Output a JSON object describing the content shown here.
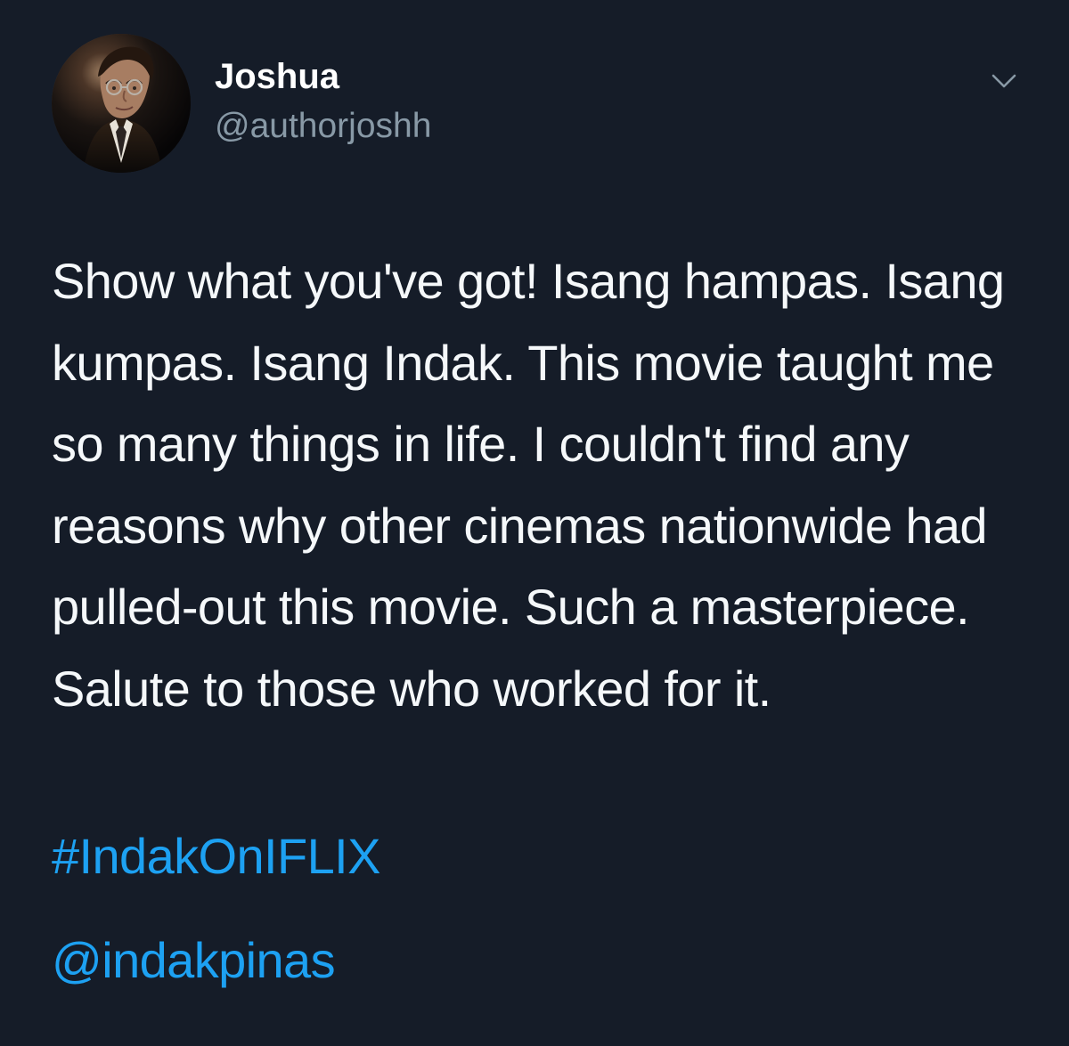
{
  "colors": {
    "background": "#151c28",
    "text": "#f5f8fa",
    "secondary_text": "#8899a6",
    "link": "#1da1f2"
  },
  "tweet": {
    "author": {
      "display_name": "Joshua",
      "username": "@authorjoshh",
      "avatar_icon": "profile-photo"
    },
    "menu_icon": "chevron-down-icon",
    "text": "Show what you've got! Isang hampas. Isang kumpas. Isang Indak. This movie taught me so many things in life. I couldn't find any reasons why other cinemas nationwide had pulled-out this movie. Such a masterpiece. Salute to those who worked for it.",
    "hashtag": "#IndakOnIFLIX",
    "mention": "@indakpinas"
  }
}
